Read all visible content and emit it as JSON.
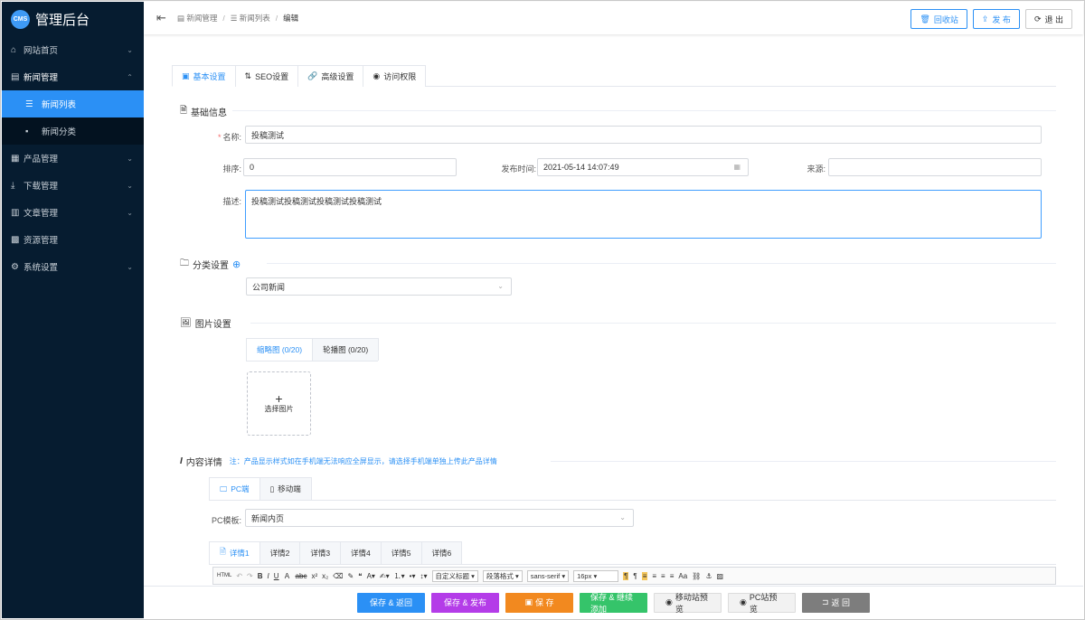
{
  "app": {
    "logo_badge": "CMS",
    "title": "管理后台"
  },
  "sidebar": {
    "items": [
      {
        "label": "网站首页",
        "icon": "⌂",
        "expanded": false
      },
      {
        "label": "新闻管理",
        "icon": "▤",
        "expanded": true
      },
      {
        "label": "产品管理",
        "icon": "▦",
        "expanded": false
      },
      {
        "label": "下载管理",
        "icon": "⤓",
        "expanded": false
      },
      {
        "label": "文章管理",
        "icon": "▥",
        "expanded": false
      },
      {
        "label": "资源管理",
        "icon": "▩",
        "expanded": false
      },
      {
        "label": "系统设置",
        "icon": "⚙",
        "expanded": false
      }
    ],
    "sub_items": [
      {
        "label": "新闻列表",
        "icon": "☰",
        "active": true
      },
      {
        "label": "新闻分类",
        "icon": "▪",
        "active": false
      }
    ]
  },
  "breadcrumb": {
    "level1": "新闻管理",
    "level2": "新闻列表",
    "current": "编辑"
  },
  "top_actions": {
    "recycle": "回收站",
    "publish": "发 布",
    "logout": "退 出"
  },
  "tabs": [
    "基本设置",
    "SEO设置",
    "高级设置",
    "访问权限"
  ],
  "basic": {
    "section_title": "基础信息",
    "name_label": "名称:",
    "name_value": "投稿测试",
    "sort_label": "排序:",
    "sort_value": "0",
    "time_label": "发布时间:",
    "time_value": "2021-05-14 14:07:49",
    "source_label": "来源:",
    "source_value": "",
    "desc_label": "描述:",
    "desc_value": "投稿测试投稿测试投稿测试投稿测试"
  },
  "category": {
    "section_title": "分类设置",
    "selected": "公司新闻"
  },
  "images": {
    "section_title": "图片设置",
    "tabs": [
      "缩略图 (0/20)",
      "轮播图 (0/20)"
    ],
    "upload_label": "选择图片"
  },
  "content": {
    "section_title": "内容详情",
    "note": "注：产品显示样式如在手机端无法响应全屏显示，请选择手机端单独上传此产品详情",
    "device_tabs": [
      "PC端",
      "移动端"
    ],
    "template_label": "PC模板:",
    "template_value": "新闻内页",
    "detail_tabs": [
      "详情1",
      "详情2",
      "详情3",
      "详情4",
      "详情5",
      "详情6"
    ]
  },
  "editor": {
    "combos": [
      "自定义标题",
      "段落格式",
      "sans-serif",
      "16px"
    ]
  },
  "bottom_actions": {
    "save_return": "保存 & 返回",
    "save_publish": "保存 & 发布",
    "save": "保 存",
    "save_continue": "保存 & 继续添加",
    "mobile_preview": "移动站预览",
    "pc_preview": "PC站预览",
    "back": "返 回"
  }
}
